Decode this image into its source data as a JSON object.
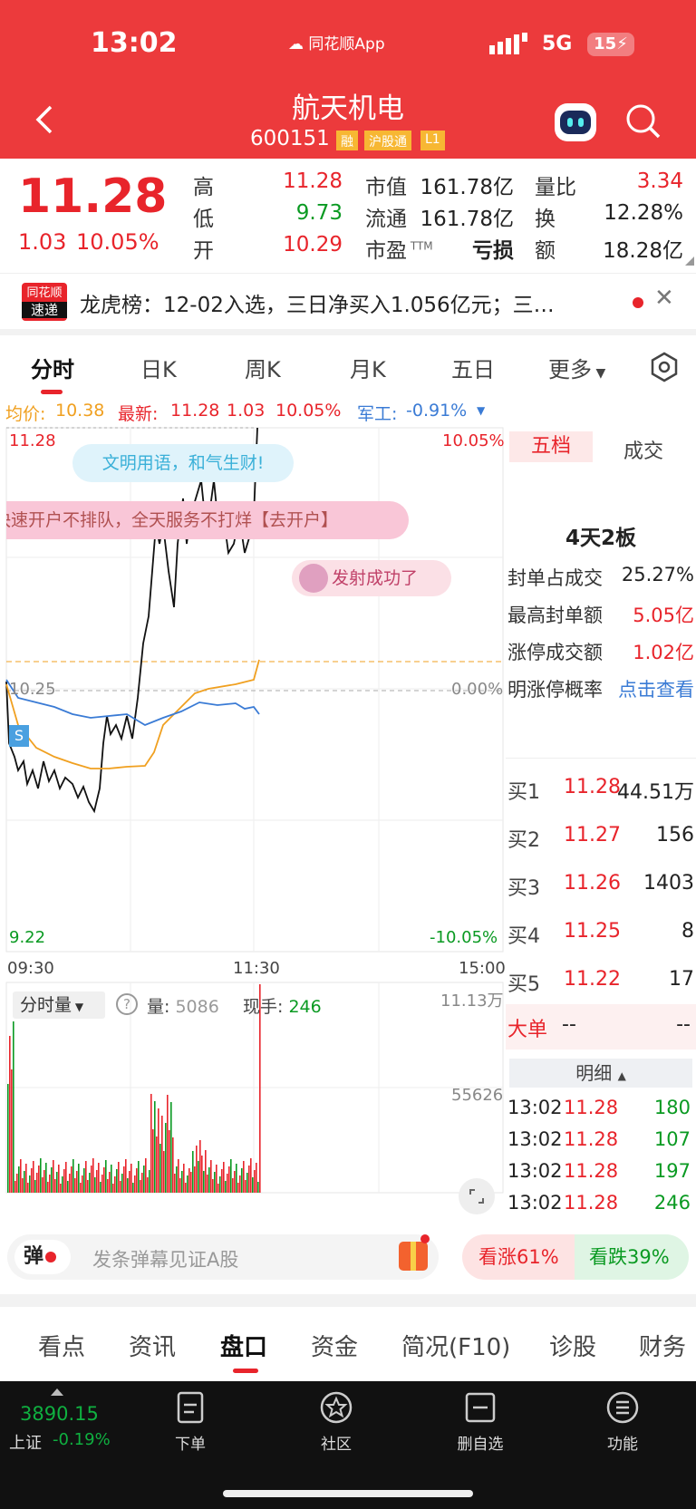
{
  "status": {
    "time": "13:02",
    "app": "同花顺App",
    "network": "5G",
    "battery": "15"
  },
  "header": {
    "title": "航天机电",
    "code": "600151",
    "badges": [
      "融",
      "沪股通",
      "L1"
    ]
  },
  "quote": {
    "price": "11.28",
    "change": "1.03",
    "pct": "10.05%",
    "fields": [
      {
        "label": "高",
        "value": "11.28"
      },
      {
        "label": "低",
        "value": "9.73"
      },
      {
        "label": "开",
        "value": "10.29"
      }
    ],
    "fields2": [
      {
        "label": "市值",
        "value": "161.78亿"
      },
      {
        "label": "流通",
        "value": "161.78亿"
      },
      {
        "label": "市盈",
        "sup": "TTM",
        "value": "亏损"
      }
    ],
    "fields3": [
      {
        "label": "量比",
        "value": "3.34"
      },
      {
        "label": "换",
        "value": "12.28%"
      },
      {
        "label": "额",
        "value": "18.28亿"
      }
    ]
  },
  "news": {
    "logo_top": "同花顺",
    "logo_bottom": "速递",
    "text": "龙虎榜：12-02入选，三日净买入1.056亿元；三…"
  },
  "tabs": [
    "分时",
    "日K",
    "周K",
    "月K",
    "五日",
    "更多"
  ],
  "infobar": {
    "avg_label": "均价:",
    "avg": "10.38",
    "latest_label": "最新:",
    "latest": "11.28",
    "chg": "1.03",
    "pct": "10.05%",
    "sector": "军工:",
    "sector_pct": "-0.91%"
  },
  "chart": {
    "top_price": "11.28",
    "top_pct": "10.05%",
    "mid_price": "10.25",
    "mid_pct": "0.00%",
    "bot_price": "9.22",
    "bot_pct": "-10.05%",
    "time_start": "09:30",
    "time_mid": "11:30",
    "time_end": "15:00",
    "bubble1": "文明用语，和气生财!",
    "bubble2": "快速开户不排队，全天服务不打烊【去开户】",
    "bubble3": "发射成功了",
    "s_marker": "S",
    "vol_label": "分时量",
    "vol_amount_label": "量:",
    "vol_amount": "5086",
    "vol_hand_label": "现手:",
    "vol_hand": "246",
    "vol_top": "11.13万",
    "vol_mid": "55626"
  },
  "chart_data": {
    "type": "line",
    "title": "",
    "x_range": [
      "09:30",
      "15:00"
    ],
    "ylim": [
      9.22,
      11.28
    ],
    "prev_close": 10.25,
    "limit_up": 11.28
  },
  "side": {
    "tab1": "五档",
    "tab2": "成交",
    "board": "4天2板",
    "stats": [
      {
        "label": "封单占成交",
        "value": "25.27%"
      },
      {
        "label": "最高封单额",
        "value": "5.05亿"
      },
      {
        "label": "涨停成交额",
        "value": "1.02亿"
      }
    ],
    "prob_label": "明涨停概率",
    "prob_link": "点击查看",
    "bids": [
      {
        "label": "买1",
        "price": "11.28",
        "vol": "44.51万"
      },
      {
        "label": "买2",
        "price": "11.27",
        "vol": "156"
      },
      {
        "label": "买3",
        "price": "11.26",
        "vol": "1403"
      },
      {
        "label": "买4",
        "price": "11.25",
        "vol": "8"
      },
      {
        "label": "买5",
        "price": "11.22",
        "vol": "17"
      }
    ],
    "bigorder_label": "大单",
    "bigorder_v1": "--",
    "bigorder_v2": "--",
    "detail_label": "明细",
    "trades": [
      {
        "t": "13:02",
        "p": "11.28",
        "v": "180"
      },
      {
        "t": "13:02",
        "p": "11.28",
        "v": "107"
      },
      {
        "t": "13:02",
        "p": "11.28",
        "v": "197"
      },
      {
        "t": "13:02",
        "p": "11.28",
        "v": "246"
      }
    ]
  },
  "danmu": {
    "icon": "弹",
    "placeholder": "发条弹幕见证A股",
    "up": "看涨61%",
    "down": "看跌39%"
  },
  "bottabs": [
    "看点",
    "资讯",
    "盘口",
    "资金",
    "简况(F10)",
    "诊股",
    "财务"
  ],
  "navbar": {
    "index_value": "3890.15",
    "index_name": "上证",
    "index_pct": "-0.19%",
    "items": [
      "下单",
      "社区",
      "删自选",
      "功能"
    ]
  }
}
